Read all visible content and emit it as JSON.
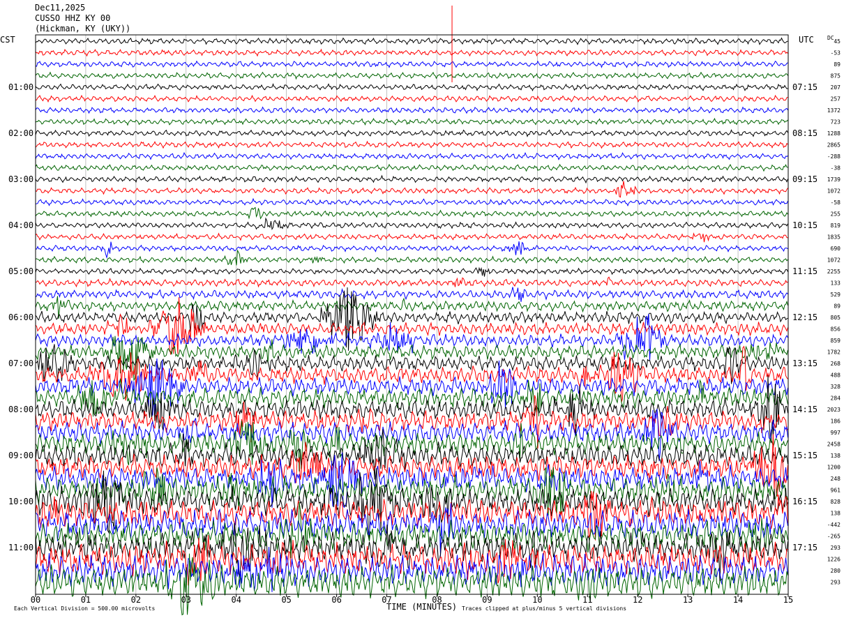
{
  "header": {
    "date": "Dec11,2025",
    "station": "CUSSO HHZ KY 00",
    "location": "(Hickman, KY (UKY))"
  },
  "left_tz": "CST",
  "right_tz": "UTC",
  "dc_label": "DC",
  "xlabel": "TIME (MINUTES)",
  "footer": {
    "left": "Each Vertical Division =  500.00 microvolts",
    "right": "Traces clipped at plus/minus 5 vertical divisions"
  },
  "colors": {
    "trace_cycle": [
      "#000000",
      "#ff0000",
      "#0000ff",
      "#006400"
    ]
  },
  "chart_data": {
    "type": "line",
    "title": "",
    "x_ticks": [
      "00",
      "01",
      "02",
      "03",
      "04",
      "05",
      "06",
      "07",
      "08",
      "09",
      "10",
      "11",
      "12",
      "13",
      "14",
      "15"
    ],
    "xlim": [
      0,
      15
    ],
    "grid": true,
    "num_traces": 48,
    "traces_per_hour": 4,
    "left_hour_labels": [
      "01:00",
      "02:00",
      "03:00",
      "04:00",
      "05:00",
      "06:00",
      "07:00",
      "08:00",
      "09:00",
      "10:00",
      "11:00"
    ],
    "right_hour_labels": [
      "07:15",
      "08:15",
      "09:15",
      "10:15",
      "11:15",
      "12:15",
      "13:15",
      "14:15",
      "15:15",
      "16:15",
      "17:15"
    ],
    "dc_offsets": [
      "45",
      "-53",
      "89",
      "875",
      "207",
      "257",
      "1372",
      "723",
      "1288",
      "2865",
      "-288",
      "-38",
      "1739",
      "1072",
      "-58",
      "255",
      "819",
      "1835",
      "690",
      "1072",
      "2255",
      "133",
      "529",
      "89",
      "805",
      "856",
      "859",
      "1782",
      "268",
      "488",
      "328",
      "284",
      "2023",
      "186",
      "997",
      "2458",
      "138",
      "1200",
      "248",
      "961",
      "828",
      "138",
      "-442",
      "-265",
      "293",
      "1226",
      "280",
      "293"
    ]
  }
}
